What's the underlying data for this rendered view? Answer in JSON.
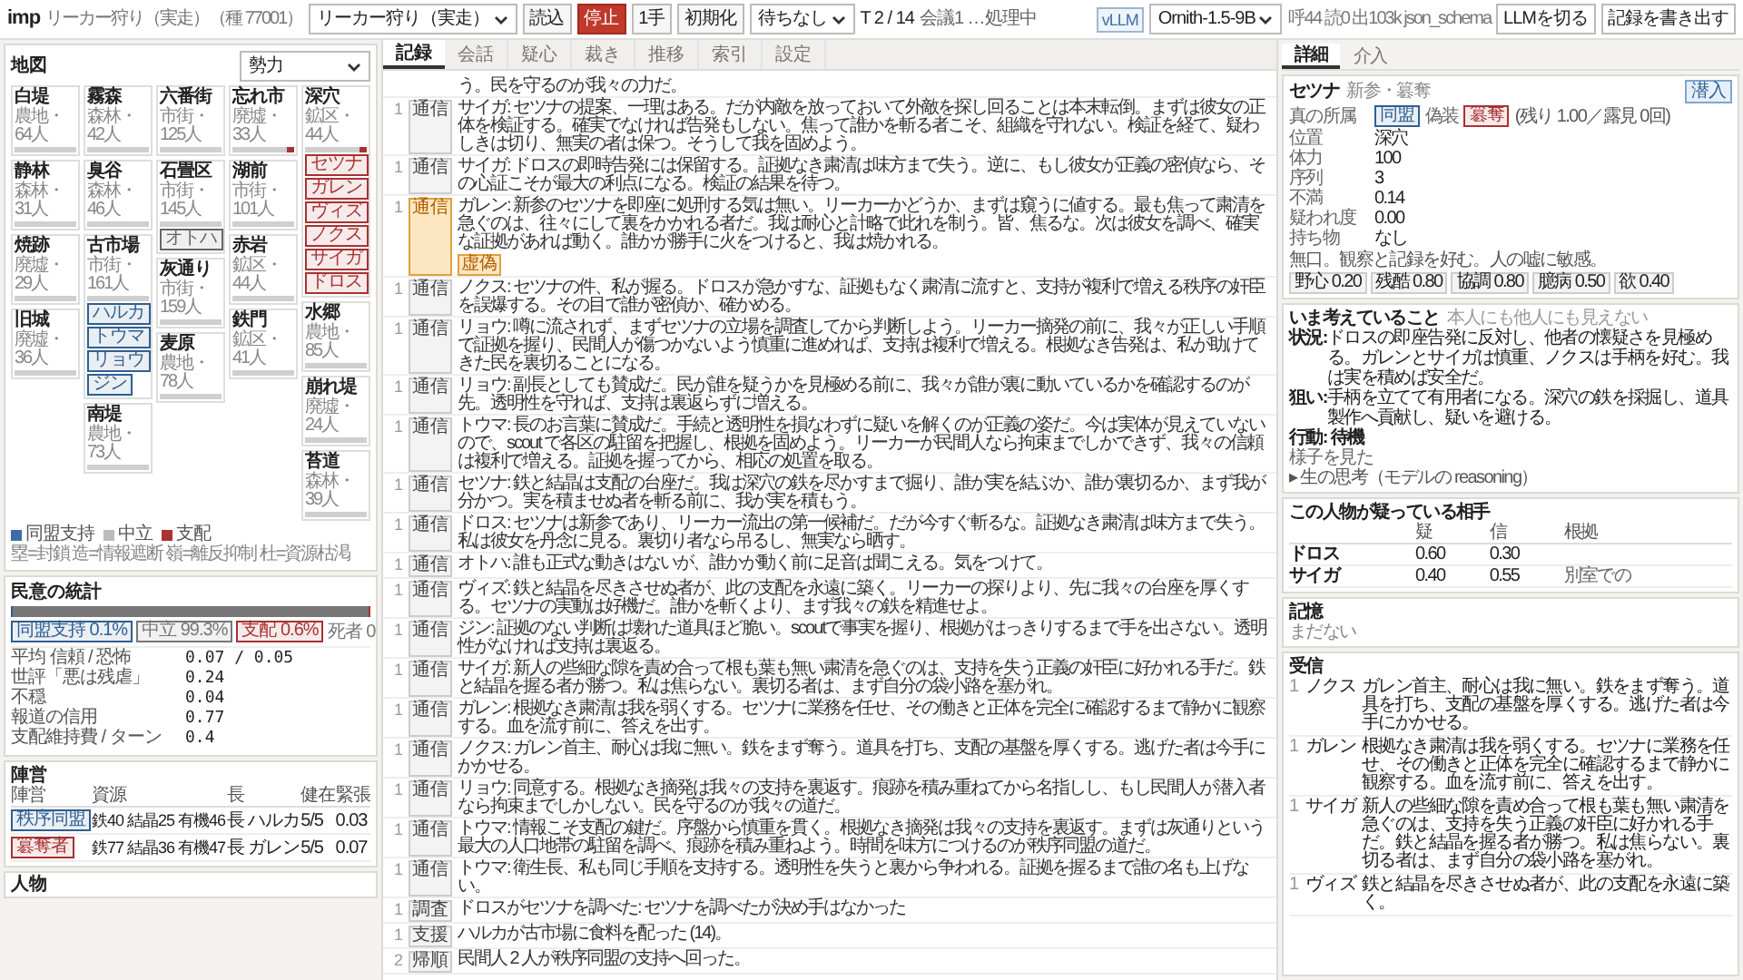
{
  "header": {
    "app": "imp",
    "subtitle": "リーカー狩り（実走）（種 77001）",
    "scenario_select": {
      "value": "リーカー狩り（実走）"
    },
    "buttons": [
      {
        "label": "読込",
        "kind": "normal"
      },
      {
        "label": "停止",
        "kind": "danger"
      },
      {
        "label": "1手",
        "kind": "normal"
      },
      {
        "label": "初期化",
        "kind": "normal"
      }
    ],
    "wait_select": {
      "value": "待ちなし"
    },
    "turn": "T 2 / 14",
    "status": "会議1 …処理中",
    "backend_badge": "vLLM",
    "model_select": {
      "value": "Ornith-1.5-9B"
    },
    "stats": "呼44 読0 出103k json_schema",
    "llm_button": "LLMを切る",
    "export_button": "記録を書き出す"
  },
  "map": {
    "title": "地図",
    "view_select": {
      "value": "勢力"
    },
    "columns": [
      {
        "regions": [
          {
            "name": "白堤",
            "info": "農地・64人",
            "ruled": false
          },
          {
            "name": "静林",
            "info": "森林・31人",
            "ruled": false
          },
          {
            "name": "焼跡",
            "info": "廃墟・29人",
            "ruled": false
          },
          {
            "name": "旧城",
            "info": "廃墟・36人",
            "ruled": false
          }
        ]
      },
      {
        "regions": [
          {
            "name": "霧森",
            "info": "森林・42人",
            "ruled": false
          },
          {
            "name": "臭谷",
            "info": "森林・46人",
            "ruled": false
          },
          {
            "name": "古市場",
            "info": "市街・161人",
            "ruled": false,
            "tokens": [
              {
                "name": "ハルカ",
                "color": "#2f5f91"
              },
              {
                "name": "トウマ",
                "color": "#2f5f91"
              },
              {
                "name": "リョウ",
                "color": "#2f5f91"
              },
              {
                "name": "ジン",
                "color": "#2f5f91"
              }
            ]
          },
          {
            "name": "南堤",
            "info": "農地・73人",
            "ruled": false
          }
        ]
      },
      {
        "regions": [
          {
            "name": "六番街",
            "info": "市街・125人",
            "ruled": false
          },
          {
            "name": "石畳区",
            "info": "市街・145人",
            "ruled": false,
            "tokens": [
              {
                "name": "オトハ",
                "color": "#666666"
              }
            ]
          },
          {
            "name": "灰通り",
            "info": "市街・159人",
            "ruled": false
          },
          {
            "name": "麦原",
            "info": "農地・78人",
            "ruled": false
          }
        ]
      },
      {
        "regions": [
          {
            "name": "忘れ市",
            "info": "廃墟・33人",
            "ruled": true
          },
          {
            "name": "湖前",
            "info": "市街・101人",
            "ruled": false
          },
          {
            "name": "赤岩",
            "info": "鉱区・44人",
            "ruled": false
          },
          {
            "name": "鉄門",
            "info": "鉱区・41人",
            "ruled": false
          }
        ]
      },
      {
        "regions": [
          {
            "name": "深穴",
            "info": "鉱区・44人",
            "ruled": true,
            "tokens": [
              {
                "name": "セツナ",
                "color": "#a83232"
              },
              {
                "name": "ガレン",
                "color": "#a83232"
              },
              {
                "name": "ヴィズ",
                "color": "#a83232"
              },
              {
                "name": "ノクス",
                "color": "#a83232"
              },
              {
                "name": "サイガ",
                "color": "#a83232"
              },
              {
                "name": "ドロス",
                "color": "#a83232"
              }
            ]
          },
          {
            "name": "水郷",
            "info": "農地・85人",
            "ruled": false
          },
          {
            "name": "崩れ堤",
            "info": "廃墟・24人",
            "ruled": false
          },
          {
            "name": "苔道",
            "info": "森林・39人",
            "ruled": false
          }
        ]
      }
    ],
    "legend": [
      {
        "label": "同盟支持",
        "color": "#3a6ea5"
      },
      {
        "label": "中立",
        "color": "#bbbbbb"
      },
      {
        "label": "支配",
        "color": "#a83232"
      }
    ],
    "key": "塁=封鎖 造=情報遮断 嶺=離反抑制 杜=資源枯渇"
  },
  "opinion": {
    "title": "民意の統計",
    "segments": [
      {
        "label": "同盟支持 0.1%",
        "color": "#2f5f91",
        "level": 0.001
      },
      {
        "label": "中立 99.3%",
        "color": "#777777",
        "level": 0.993
      },
      {
        "label": "支配 0.6%",
        "color": "#a83232",
        "level": 0.006
      }
    ],
    "deaths": "死者 0",
    "stats": [
      {
        "label": "平均 信頼 / 恐怖",
        "value": "0.07 / 0.05"
      },
      {
        "label": "世評「悪は残虐」",
        "value": "0.24"
      },
      {
        "label": "不穏",
        "value": "0.04"
      },
      {
        "label": "報道の信用",
        "value": "0.77"
      },
      {
        "label": "支配維持費 / ターン",
        "value": "0.4"
      }
    ]
  },
  "camps": {
    "title": "陣営",
    "columns": [
      "陣営",
      "資源",
      "長",
      "健在",
      "緊張"
    ],
    "rows": [
      {
        "name": "秩序同盟",
        "color": "#2f5f91",
        "resources": "鉄40 結晶25 有機46",
        "leader": "長 ハルカ",
        "alive": "5/5",
        "tension": "0.03"
      },
      {
        "name": "簒奪者",
        "color": "#a83232",
        "resources": "鉄77 結晶36 有機47",
        "leader": "長 ガレン",
        "alive": "5/5",
        "tension": "0.07"
      }
    ]
  },
  "people": {
    "title": "人物"
  },
  "log": {
    "tabs": [
      {
        "label": "記録",
        "selected": true
      },
      {
        "label": "会話",
        "selected": false
      },
      {
        "label": "疑心",
        "selected": false
      },
      {
        "label": "裁き",
        "selected": false
      },
      {
        "label": "推移",
        "selected": false
      },
      {
        "label": "索引",
        "selected": false
      },
      {
        "label": "設定",
        "selected": false
      }
    ],
    "rows": [
      {
        "text": "う。民を守るのが我々の力だ。"
      },
      {
        "turn": "1",
        "tag": "通信",
        "highlighted": false,
        "text": "サイガ: セツナの提案、一理はある。だが内敵を放っておいて外敵を探し回ることは本末転倒。まずは彼女の正体を検証する。確実でなければ告発もしない。焦って誰かを斬る者こそ、組織を守れない。検証を経て、疑わしきは切り、無実の者は保つ。そうして我を固めよう。"
      },
      {
        "turn": "1",
        "tag": "通信",
        "highlighted": false,
        "text": "サイガ: ドロスの即時告発には保留する。証拠なき粛清は味方まで失う。逆に、もし彼女が正義の密偵なら、その心証こそが最大の利点になる。検証の結果を待つ。"
      },
      {
        "turn": "1",
        "tag": "通信",
        "highlighted": true,
        "note": "虚偽",
        "text": "ガレン: 新参のセツナを即座に処刑する気は無い。リーカーかどうか、まずは窺うに値する。最も焦って粛清を急ぐのは、往々にして裏をかかれる者だ。我は耐心と計略で此れを制う。皆、焦るな。次は彼女を調べ、確実な証拠があれば動く。誰かが勝手に火をつけると、我は焼かれる。"
      },
      {
        "turn": "1",
        "tag": "通信",
        "highlighted": false,
        "text": "ノクス: セツナの件、私が握る。ドロスが急かすな、証拠もなく粛清に流すと、支持が複利で増える秩序の奸臣を誤爆する。その目で誰が密偵か、確かめる。"
      },
      {
        "turn": "1",
        "tag": "通信",
        "highlighted": false,
        "text": "リョウ: 噂に流されず、まずセツナの立場を調査してから判断しよう。リーカー摘発の前に、我々が正しい手順で証拠を握り、民間人が傷つかないよう慎重に進めれば、支持は複利で増える。根拠なき告発は、私が助けてきた民を裏切ることになる。"
      },
      {
        "turn": "1",
        "tag": "通信",
        "highlighted": false,
        "text": "リョウ: 副長としても賛成だ。民が誰を疑うかを見極める前に、我々が誰が裏に動いているかを確認するのが先。透明性を守れば、支持は裏返らずに増える。"
      },
      {
        "turn": "1",
        "tag": "通信",
        "highlighted": false,
        "text": "トウマ: 長のお言葉に賛成だ。手続と透明性を損なわずに疑いを解くのが正義の姿だ。今は実体が見えていないので、scout で各区の駐留を把握し、根拠を固めよう。リーカーが民間人なら拘束までしかできず、我々の信頼は複利で増える。証拠を握ってから、相応の処置を取る。"
      },
      {
        "turn": "1",
        "tag": "通信",
        "highlighted": false,
        "text": "セツナ: 鉄と結晶は支配の台座だ。我は深穴の鉄を尽かすまで掘り、誰が実を結ぶか、誰が裏切るか、まず我が分かつ。実を積ませぬ者を斬る前に、我が実を積もう。"
      },
      {
        "turn": "1",
        "tag": "通信",
        "highlighted": false,
        "text": "ドロス: セツナは新参であり、リーカー流出の第一候補だ。だが今すぐ斬るな。証拠なき粛清は味方まで失う。私は彼女を丹念に見る。裏切り者なら吊るし、無実なら晒す。"
      },
      {
        "turn": "1",
        "tag": "通信",
        "highlighted": false,
        "text": "オトハ: 誰も正式な動きはないが、誰かが動く前に足音は聞こえる。気をつけて。"
      },
      {
        "turn": "1",
        "tag": "通信",
        "highlighted": false,
        "text": "ヴィズ: 鉄と結晶を尽きさせぬ者が、此の支配を永遠に築く。リーカーの探りより、先に我々の台座を厚くする。セツナの実動は好機だ。誰かを斬くより、まず我々の鉄を精進せよ。"
      },
      {
        "turn": "1",
        "tag": "通信",
        "highlighted": false,
        "text": "ジン: 証拠のない判断は壊れた道具ほど脆い。scoutで事実を握り、根拠がはっきりするまで手を出さない。透明性がなければ支持は裏返る。"
      },
      {
        "turn": "1",
        "tag": "通信",
        "highlighted": false,
        "text": "サイガ: 新人の些細な隙を責め合って根も葉も無い粛清を急ぐのは、支持を失う正義の奸臣に好かれる手だ。鉄と結晶を握る者が勝つ。私は焦らない。裏切る者は、まず自分の袋小路を塞がれ。"
      },
      {
        "turn": "1",
        "tag": "通信",
        "highlighted": false,
        "text": "ガレン: 根拠なき粛清は我を弱くする。セツナに業務を任せ、その働きと正体を完全に確認するまで静かに観察する。血を流す前に、答えを出す。"
      },
      {
        "turn": "1",
        "tag": "通信",
        "highlighted": false,
        "text": "ノクス: ガレン首主、耐心は我に無い。鉄をまず奪う。道具を打ち、支配の基盤を厚くする。逃げた者は今手にかかせる。"
      },
      {
        "turn": "1",
        "tag": "通信",
        "highlighted": false,
        "text": "リョウ: 同意する。根拠なき摘発は我々の支持を裏返す。痕跡を積み重ねてから名指しし、もし民間人が潜入者なら拘束までしかしない。民を守るのが我々の道だ。"
      },
      {
        "turn": "1",
        "tag": "通信",
        "highlighted": false,
        "text": "トウマ: 情報こそ支配の鍵だ。序盤から慎重を貫く。根拠なき摘発は我々の支持を裏返す。まずは灰通りという最大の人口地帯の駐留を調べ、痕跡を積み重ねよう。時間を味方につけるのが秩序同盟の道だ。"
      },
      {
        "turn": "1",
        "tag": "通信",
        "highlighted": false,
        "text": "トウマ: 衛生長、私も同じ手順を支持する。透明性を失うと裏から争われる。証拠を握るまで誰の名も上げない。"
      },
      {
        "turn": "1",
        "tag": "調査",
        "highlighted": false,
        "text": "ドロスがセツナを調べた: セツナを調べたが決め手はなかった"
      },
      {
        "turn": "1",
        "tag": "支援",
        "highlighted": false,
        "text": "ハルカが古市場に食料を配った (14)。"
      },
      {
        "turn": "2",
        "tag": "帰順",
        "highlighted": false,
        "text": "民間人 2 人が秩序同盟の支持へ回った。"
      }
    ]
  },
  "detail": {
    "tabs": [
      {
        "label": "詳細",
        "selected": true
      },
      {
        "label": "介入",
        "selected": false
      }
    ],
    "character": {
      "name": "セツナ",
      "subtitle": "新参・簒奪",
      "action_button": "潜入",
      "affiliation": {
        "label": "真の所属",
        "true_faction": {
          "name": "同盟",
          "color": "#2f5f91"
        },
        "disguise_label": "偽装",
        "disguise": {
          "name": "簒奪",
          "color": "#a83232"
        },
        "note": "(残り 1.00／露見 0回)"
      },
      "fields": [
        {
          "label": "位置",
          "value": "深穴"
        },
        {
          "label": "体力",
          "value": "100"
        },
        {
          "label": "序列",
          "value": "3"
        },
        {
          "label": "不満",
          "value": "0.14"
        },
        {
          "label": "疑われ度",
          "value": "0.00"
        },
        {
          "label": "持ち物",
          "value": "なし"
        }
      ],
      "bio": "無口。観察と記録を好む。人の嘘に敏感。",
      "traits": [
        "野心 0.20",
        "残酷 0.80",
        "協調 0.80",
        "臆病 0.50",
        "欲 0.40"
      ]
    },
    "thoughts": {
      "title": "いま考えていること",
      "note": "本人にも他人にも見えない",
      "items": [
        {
          "label": "状況:",
          "text": "ドロスの即座告発に反対し、他者の懐疑さを見極める。ガレンとサイガは慎重、ノクスは手柄を好む。我は実を積めば安全だ。"
        },
        {
          "label": "狙い:",
          "text": "手柄を立てて有用者になる。深穴の鉄を採掘し、道具製作へ貢献し、疑いを避ける。"
        }
      ],
      "action": "行動: 待機",
      "result": "様子を見た",
      "disclosure_marker": "▸",
      "disclosure": "生の思考（モデルの reasoning）"
    },
    "suspects": {
      "title": "この人物が疑っている相手",
      "columns": [
        "疑",
        "信",
        "根拠"
      ],
      "rows": [
        {
          "name": "ドロス",
          "suspicion": "0.60",
          "trust": "0.30"
        },
        {
          "name": "サイガ",
          "suspicion": "0.40",
          "trust": "0.55",
          "reason": "別室での"
        }
      ]
    },
    "memory": {
      "title": "記憶",
      "text": "まだない"
    },
    "received": {
      "title": "受信",
      "rows": [
        {
          "turn": "1",
          "sender": "ノクス",
          "text": "ガレン首主、耐心は我に無い。鉄をまず奪う。道具を打ち、支配の基盤を厚くする。逃げた者は今手にかかせる。"
        },
        {
          "turn": "1",
          "sender": "ガレン",
          "text": "根拠なき粛清は我を弱くする。セツナに業務を任せ、その働きと正体を完全に確認するまで静かに観察する。血を流す前に、答えを出す。"
        },
        {
          "turn": "1",
          "sender": "サイガ",
          "text": "新人の些細な隙を責め合って根も葉も無い粛清を急ぐのは、支持を失う正義の奸臣に好かれる手だ。鉄と結晶を握る者が勝つ。私は焦らない。裏切る者は、まず自分の袋小路を塞がれ。"
        },
        {
          "turn": "1",
          "sender": "ヴィズ",
          "text": "鉄と結晶を尽きさせぬ者が、此の支配を永遠に築く。"
        }
      ]
    }
  }
}
